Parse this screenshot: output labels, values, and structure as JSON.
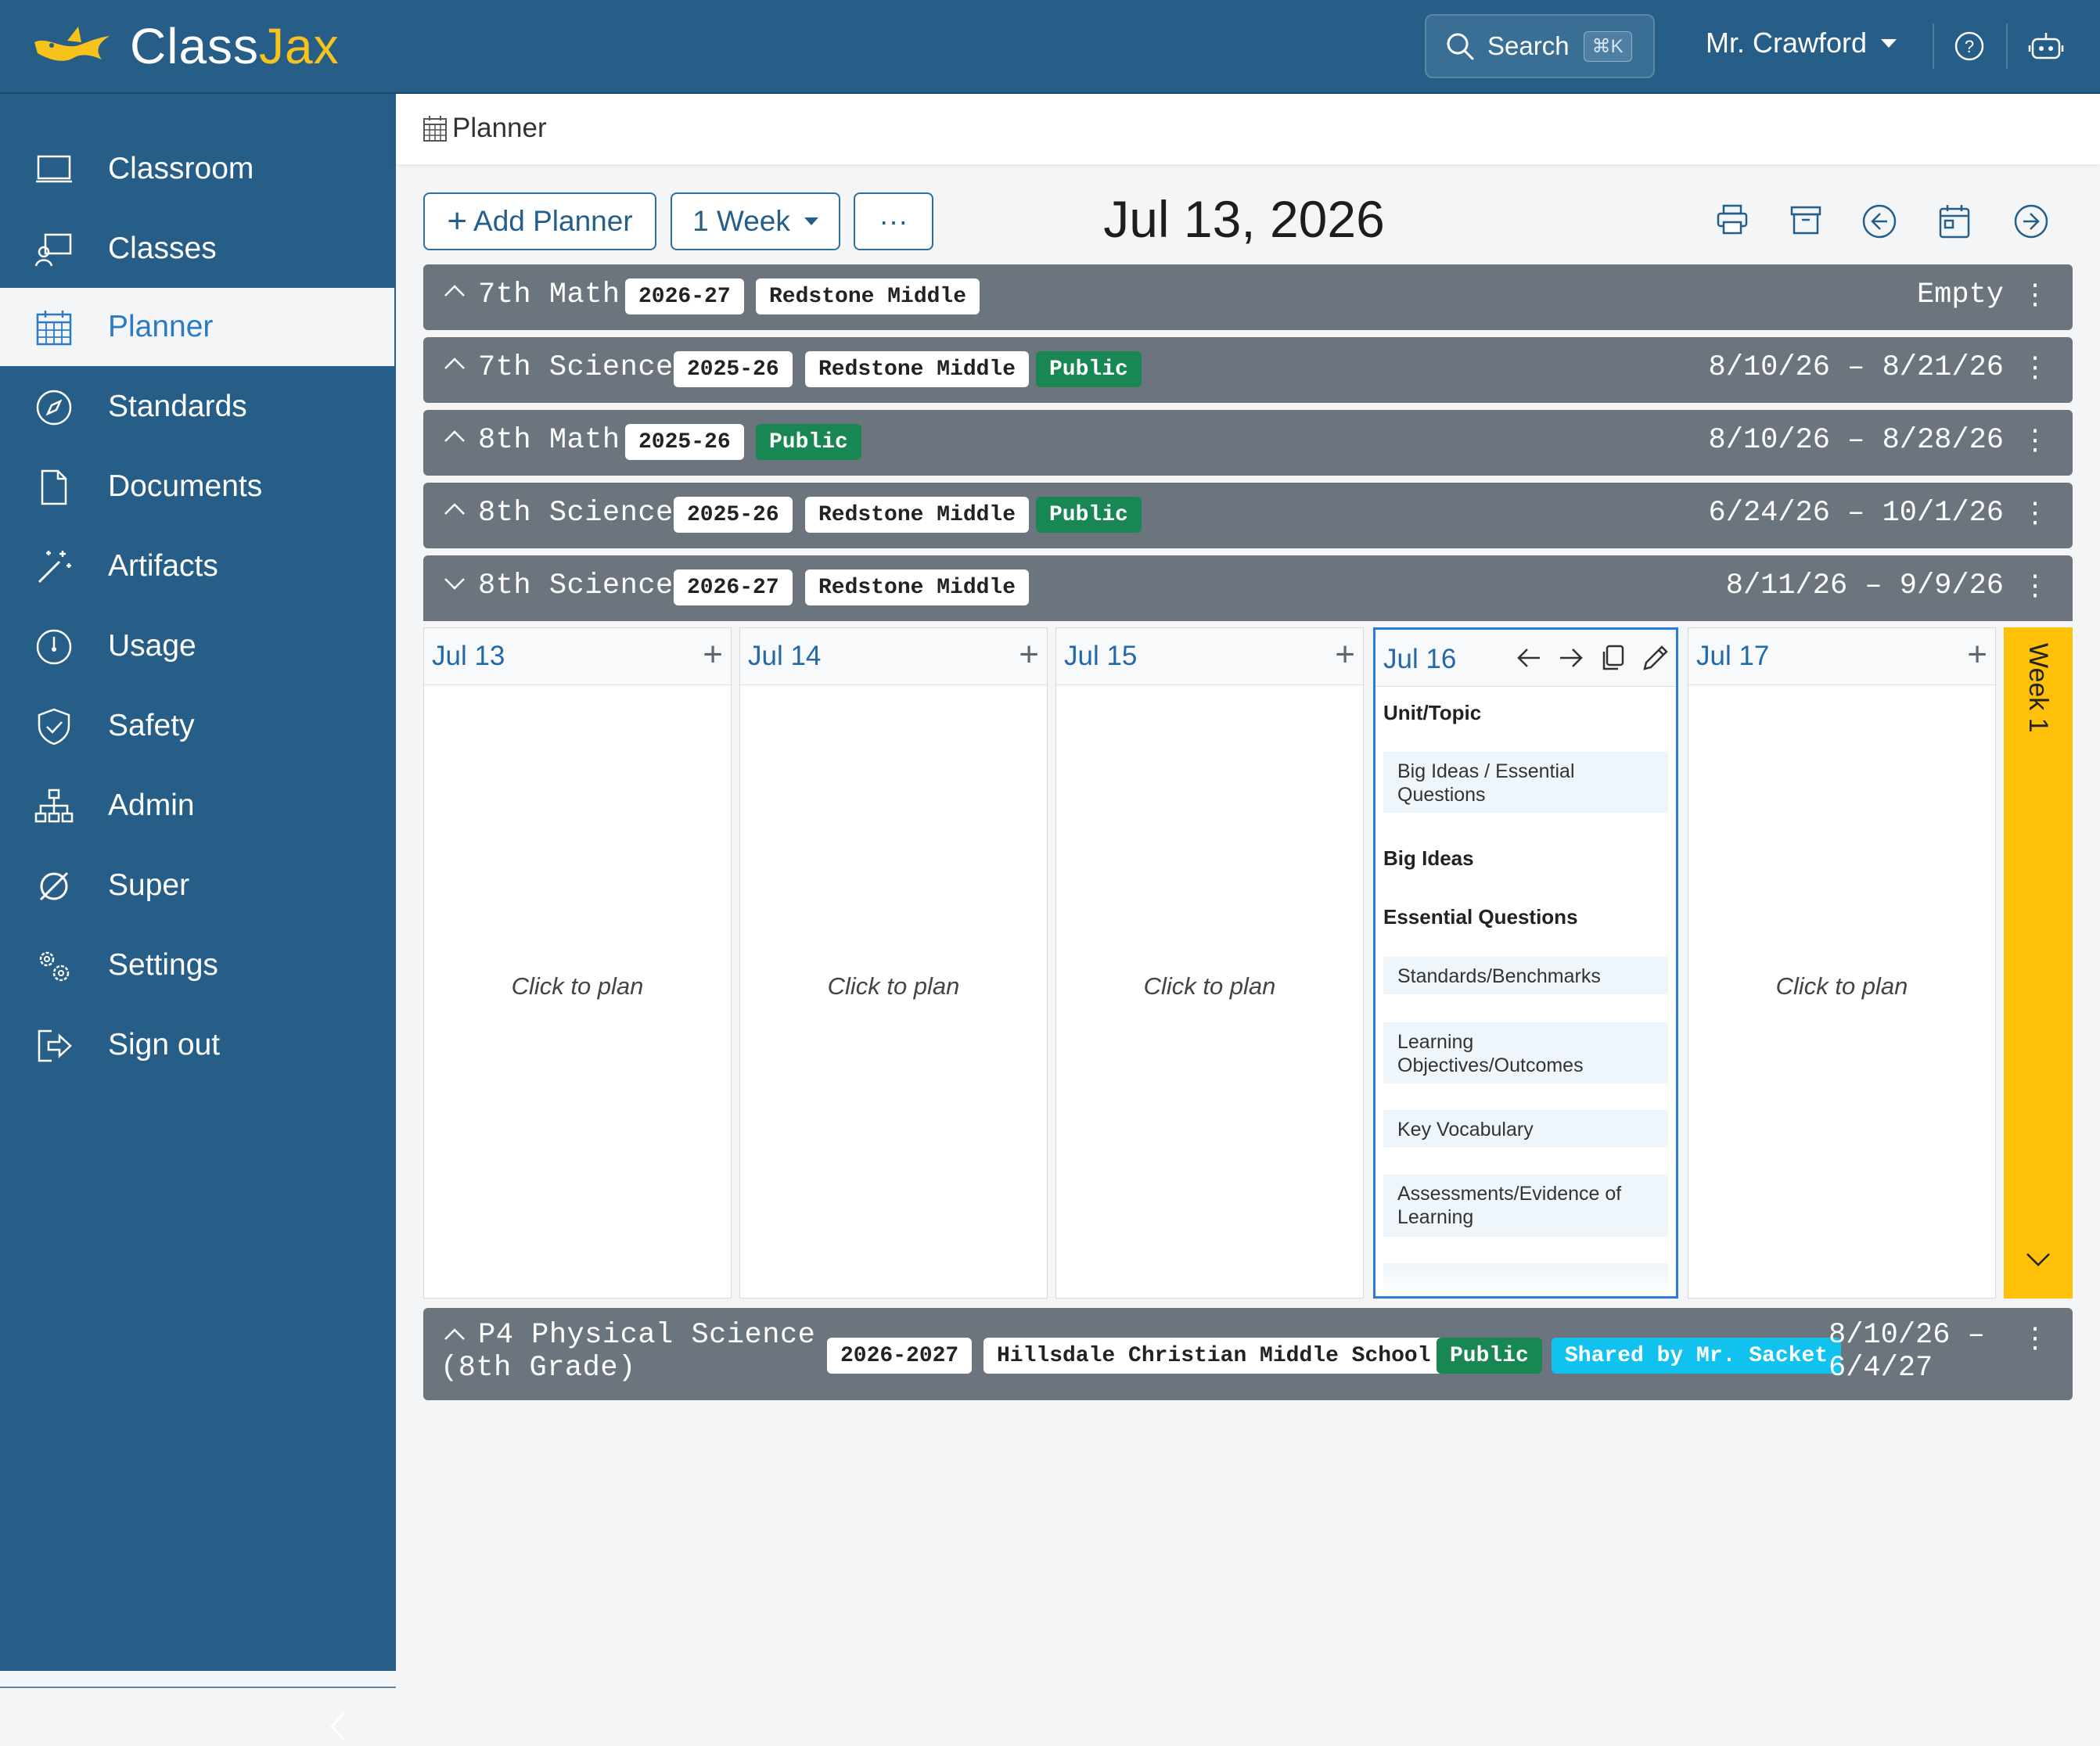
{
  "app": {
    "logo_class": "Class",
    "logo_jax": "Jax",
    "brand_color": "#265e87",
    "accent_color": "#f7c31a"
  },
  "topbar": {
    "search_label": "Search",
    "search_shortcut": "⌘K",
    "user_name": "Mr. Crawford"
  },
  "sidebar": {
    "items": [
      {
        "label": "Classroom",
        "icon": "classroom-icon"
      },
      {
        "label": "Classes",
        "icon": "classes-icon"
      },
      {
        "label": "Planner",
        "icon": "calendar-icon",
        "active": true
      },
      {
        "label": "Standards",
        "icon": "compass-icon"
      },
      {
        "label": "Documents",
        "icon": "document-icon"
      },
      {
        "label": "Artifacts",
        "icon": "magic-wand-icon"
      },
      {
        "label": "Usage",
        "icon": "speedometer-icon"
      },
      {
        "label": "Safety",
        "icon": "shield-check-icon"
      },
      {
        "label": "Admin",
        "icon": "org-chart-icon"
      },
      {
        "label": "Super",
        "icon": "super-icon"
      },
      {
        "label": "Settings",
        "icon": "gears-icon"
      },
      {
        "label": "Sign out",
        "icon": "sign-out-icon"
      }
    ]
  },
  "breadcrumb": {
    "label": "Planner"
  },
  "toolbar": {
    "add_planner": "Add Planner",
    "week_select": "1 Week",
    "more": "···",
    "date": "Jul 13, 2026"
  },
  "planners": [
    {
      "name": "7th Math",
      "year": "2026-27",
      "school": "Redstone Middle",
      "range": "Empty",
      "expanded": false
    },
    {
      "name": "7th Science",
      "year": "2025-26",
      "school": "Redstone Middle",
      "public": "Public",
      "range": "8/10/26 – 8/21/26",
      "expanded": false
    },
    {
      "name": "8th Math",
      "year": "2025-26",
      "public": "Public",
      "range": "8/10/26 – 8/28/26",
      "expanded": false
    },
    {
      "name": "8th Science",
      "year": "2025-26",
      "school": "Redstone Middle",
      "public": "Public",
      "range": "6/24/26 – 10/1/26",
      "expanded": false
    },
    {
      "name": "8th Science",
      "year": "2026-27",
      "school": "Redstone Middle",
      "range": "8/11/26 – 9/9/26",
      "expanded": true
    },
    {
      "name_line1": "P4 Physical Science",
      "name_line2": "(8th Grade)",
      "year": "2026-2027",
      "school": "Hillsdale Christian Middle School",
      "public": "Public",
      "shared": "Shared by Mr. Sacket",
      "range_line1": "8/10/26 –",
      "range_line2": "6/4/27",
      "expanded": false
    }
  ],
  "week": {
    "label": "Week 1",
    "days": [
      {
        "label": "Jul 13",
        "placeholder": "Click to plan"
      },
      {
        "label": "Jul 14",
        "placeholder": "Click to plan"
      },
      {
        "label": "Jul 15",
        "placeholder": "Click to plan"
      },
      {
        "label": "Jul 16"
      },
      {
        "label": "Jul 17",
        "placeholder": "Click to plan"
      }
    ],
    "active_day": {
      "sections": {
        "unit_topic": "Unit/Topic",
        "big_ideas": "Big Ideas",
        "essential_questions": "Essential Questions"
      },
      "items": {
        "big_ideas_eq_1": "Big Ideas / Essential",
        "big_ideas_eq_2": "Questions",
        "standards": "Standards/Benchmarks",
        "objectives_1": "Learning",
        "objectives_2": "Objectives/Outcomes",
        "vocab": "Key Vocabulary",
        "assess_1": "Assessments/Evidence of",
        "assess_2": "Learning"
      }
    }
  }
}
